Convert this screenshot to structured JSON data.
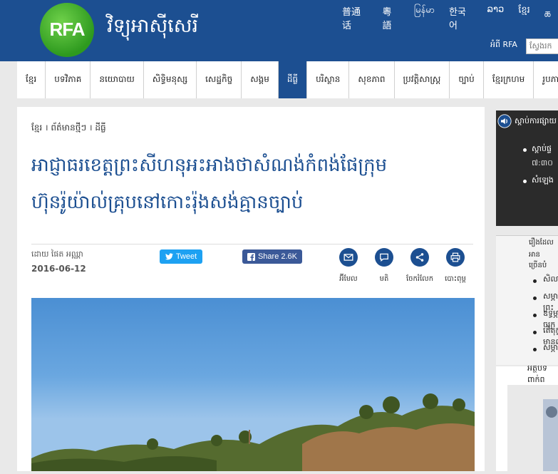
{
  "header": {
    "logo_text": "RFA",
    "site_title": "វិទ្យុអាស៊ីសេរី",
    "languages": [
      "普通话",
      "粵語",
      "မြန်မာ",
      "한국어",
      "ລາວ",
      "ខ្មែរ",
      "ཆ"
    ],
    "rfa_link": "អំពី RFA",
    "search_placeholder": "ស្វែងរក"
  },
  "nav": {
    "items": [
      "ខ្មែរ",
      "បទវិភាគ",
      "នយោបាយ",
      "សិទ្ធិមនុស្ស",
      "សេដ្ឋកិច្ច",
      "សង្គម",
      "ដីធ្លី",
      "បរិស្ថាន",
      "សុខភាព",
      "ប្រវត្តិសាស្ត្រ",
      "ច្បាប់",
      "ខ្មែរក្រហម",
      "រូបភាព"
    ],
    "active_index": 6
  },
  "article": {
    "breadcrumb": "ខ្មែរ । ព័ត៌មានថ្មីៗ । ដីធ្លី",
    "headline_line1": "អាជ្ញាធរខេត្តព្រះសីហនុអះអាងថាសំណង់កំពង់ផែក្រុម",
    "headline_line2": "ហ៊ុនរ៉ូយ៉ាល់គ្រុបនៅកោះរ៉ុងសង់គ្មានច្បាប់",
    "byline": "ដោយ ផៃត អឈ្ណា",
    "date": "2016-06-12",
    "tweet_label": "Tweet",
    "share_label": "Share 2.6K",
    "tools": [
      {
        "icon": "email-icon",
        "label": "អ៊ីមែល"
      },
      {
        "icon": "comment-icon",
        "label": "មតិ"
      },
      {
        "icon": "share-icon",
        "label": "ចែករំលែក"
      },
      {
        "icon": "print-icon",
        "label": "បោះពុម្ព"
      }
    ]
  },
  "sidebar": {
    "listen_header": "ស្ដាប់ការផ្សាយ",
    "listen_items": [
      "ស្ដាប់ផ្ទ",
      "សំឡេង"
    ],
    "listen_item_sub": "៧:៣០",
    "stories_header_1": "រឿងដែល",
    "stories_header_2": "អានច្រើនបំ",
    "stories_items": [
      "សិលាលេ",
      "សម្ភាសព្រះ",
      "ឧទ្ធម្ភាចក្រ",
      "តើតុក្ខមានល",
      "សម្ភាសលោ"
    ],
    "related_header": "អត្ថបទពាក់ព"
  },
  "colors": {
    "brand_blue": "#1c4f91",
    "logo_green": "#3aa829",
    "twitter": "#1da1f2",
    "facebook": "#3b5998"
  }
}
